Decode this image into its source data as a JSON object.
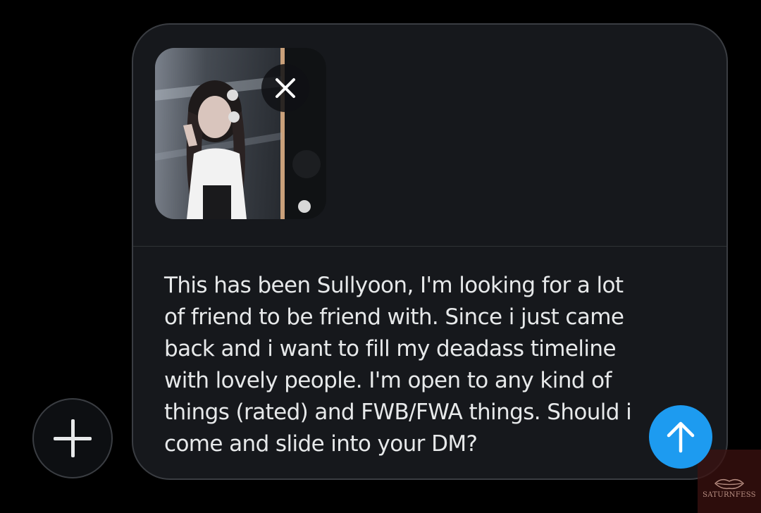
{
  "composer": {
    "message": "This has been Sullyoon, I'm looking for a lot\nof friend to be friend with. Since i just came\nback and i want to fill my deadass timeline\nwith lovely people. I'm open to any kind of\nthings (rated) and FWB/FWA things. Should i\ncome and slide into your DM?"
  },
  "icons": {
    "add": "plus-icon",
    "remove": "close-icon",
    "send": "arrow-up-icon"
  },
  "watermark": {
    "text": "SATURNFESS"
  },
  "colors": {
    "background": "#000000",
    "composer_bg": "#16181c",
    "border": "#3a3d42",
    "text": "#e7e9ea",
    "accent": "#1d9bf0"
  }
}
